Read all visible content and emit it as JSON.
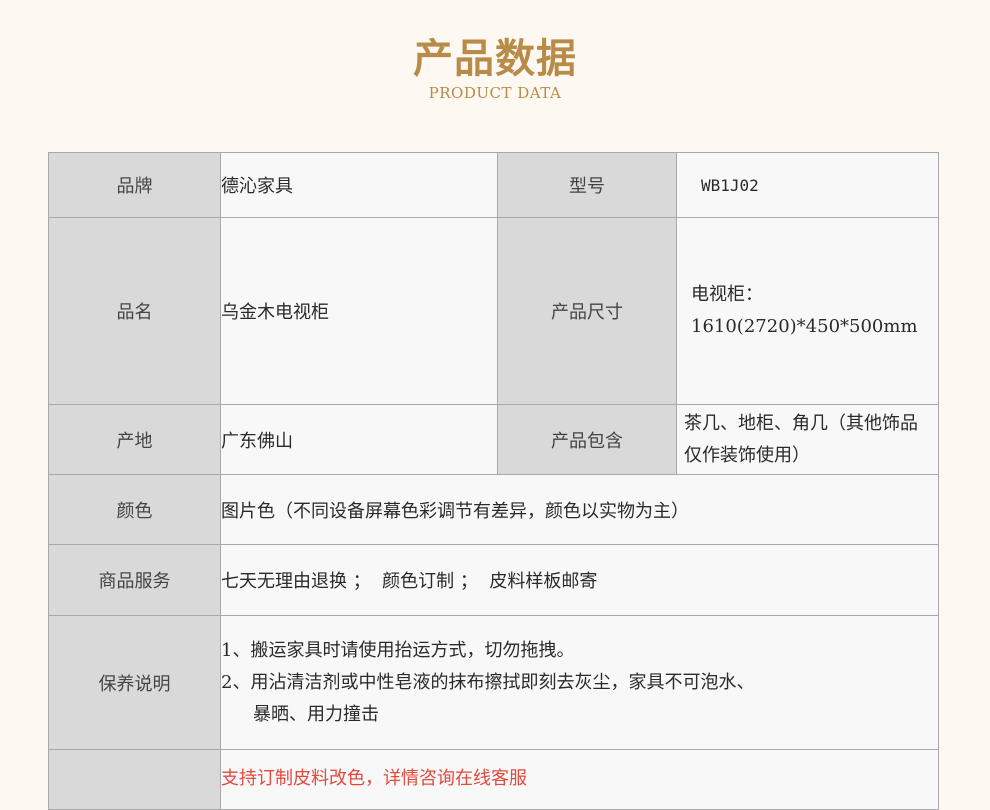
{
  "header": {
    "title": "产品数据",
    "subtitle": "PRODUCT DATA"
  },
  "spec": {
    "brand_label": "品牌",
    "brand_value": "德沁家具",
    "model_label": "型号",
    "model_value": "WB1J02",
    "name_label": "品名",
    "name_value": "乌金木电视柜",
    "size_label": "产品尺寸",
    "size_lines": [
      "电视柜：",
      "1610(2720)*450*500mm"
    ],
    "origin_label": "产地",
    "origin_value": "广东佛山",
    "package_label": "产品包含",
    "package_lines": [
      "茶几、地柜、角几（其他饰品",
      "仅作装饰使用）"
    ],
    "color_label": "颜色",
    "color_value": "图片色（不同设备屏幕色彩调节有差异，颜色以实物为主）",
    "service_label": "商品服务",
    "service_value": "七天无理由退换 ；  颜色订制 ；  皮料样板邮寄",
    "care_label": "保养说明",
    "care_lines": [
      "1、搬运家具时请使用抬运方式，切勿拖拽。",
      "2、用沾清洁剂或中性皂液的抹布擦拭即刻去灰尘，家具不可泡水、",
      "暴晒、用力撞击"
    ],
    "custom_note": "支持订制皮料改色，详情咨询在线客服"
  },
  "colors": {
    "accent": "#b98b48",
    "label_bg": "#d9d9d9",
    "value_bg": "#f8f8f8",
    "note": "#e34a3e"
  }
}
